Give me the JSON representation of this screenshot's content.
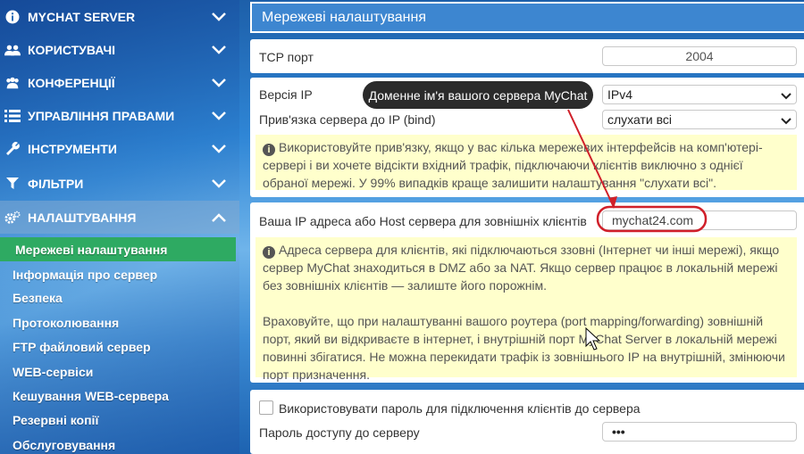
{
  "sidebar": {
    "items": [
      {
        "label": "MYCHAT SERVER",
        "icon": "info-icon",
        "chevron": "down"
      },
      {
        "label": "КОРИСТУВАЧІ",
        "icon": "users-icon",
        "chevron": "down"
      },
      {
        "label": "КОНФЕРЕНЦІЇ",
        "icon": "conference-icon",
        "chevron": "down"
      },
      {
        "label": "УПРАВЛІННЯ ПРАВАМИ",
        "icon": "list-icon",
        "chevron": "down"
      },
      {
        "label": "ІНСТРУМЕНТИ",
        "icon": "wrench-icon",
        "chevron": "down"
      },
      {
        "label": "ФІЛЬТРИ",
        "icon": "filter-icon",
        "chevron": "down"
      },
      {
        "label": "НАЛАШТУВАННЯ",
        "icon": "gears-icon",
        "chevron": "up"
      }
    ],
    "subitems": [
      "Мережеві налаштування",
      "Інформація про сервер",
      "Безпека",
      "Протоколювання",
      "FTP файловий сервер",
      "WEB-сервіси",
      "Кешування WEB-сервера",
      "Резервні копії",
      "Обслуговування"
    ]
  },
  "header": {
    "title": "Мережеві налаштування"
  },
  "tcp": {
    "label": "TCP порт",
    "value": "2004"
  },
  "ip": {
    "version_label": "Версія IP",
    "version_value": "IPv4",
    "bind_label": "Прив'язка сервера до IP (bind)",
    "bind_value": "слухати всі",
    "note": "Використовуйте прив'язку, якщо у вас кілька мережевих інтерфейсів на комп'ютері-сервері і ви хочете відсікти вхідний трафік, підключаючи клієнтів виключно з однієї обраної мережі. У 99% випадків краще залишити налаштування \"слухати всі\"."
  },
  "host": {
    "label": "Ваша IP адреса або Host сервера для зовнішніх клієнтів",
    "value": "mychat24.com",
    "note1": "Адреса сервера для клієнтів, які підключаються ззовні (Інтернет чи інші мережі), якщо сервер MyChat знаходиться в DMZ або за NAT. Якщо сервер працює в локальній мережі без зовнішніх клієнтів — залиште його порожнім.",
    "note2": "Враховуйте, що при налаштуванні вашого роутера (port mapping/forwarding) зовнішній порт, який ви відкриваєте в інтернет, і внутрішній порт MyChat Server в локальній мережі повинні збігатися. Не можна перекидати трафік із зовнішнього IP на внутрішній, змінюючи порт призначення."
  },
  "password": {
    "checkbox_label": "Використовувати пароль для підключення клієнтів до сервера",
    "label": "Пароль доступу до серверу",
    "value": "•••"
  },
  "tooltip": {
    "text": "Доменне ім'я вашого сервера MyChat"
  },
  "colors": {
    "accent": "#3d86d0",
    "active_subitem": "#2eaa62",
    "note_bg": "#ffffcc",
    "highlight": "#d0202a"
  }
}
